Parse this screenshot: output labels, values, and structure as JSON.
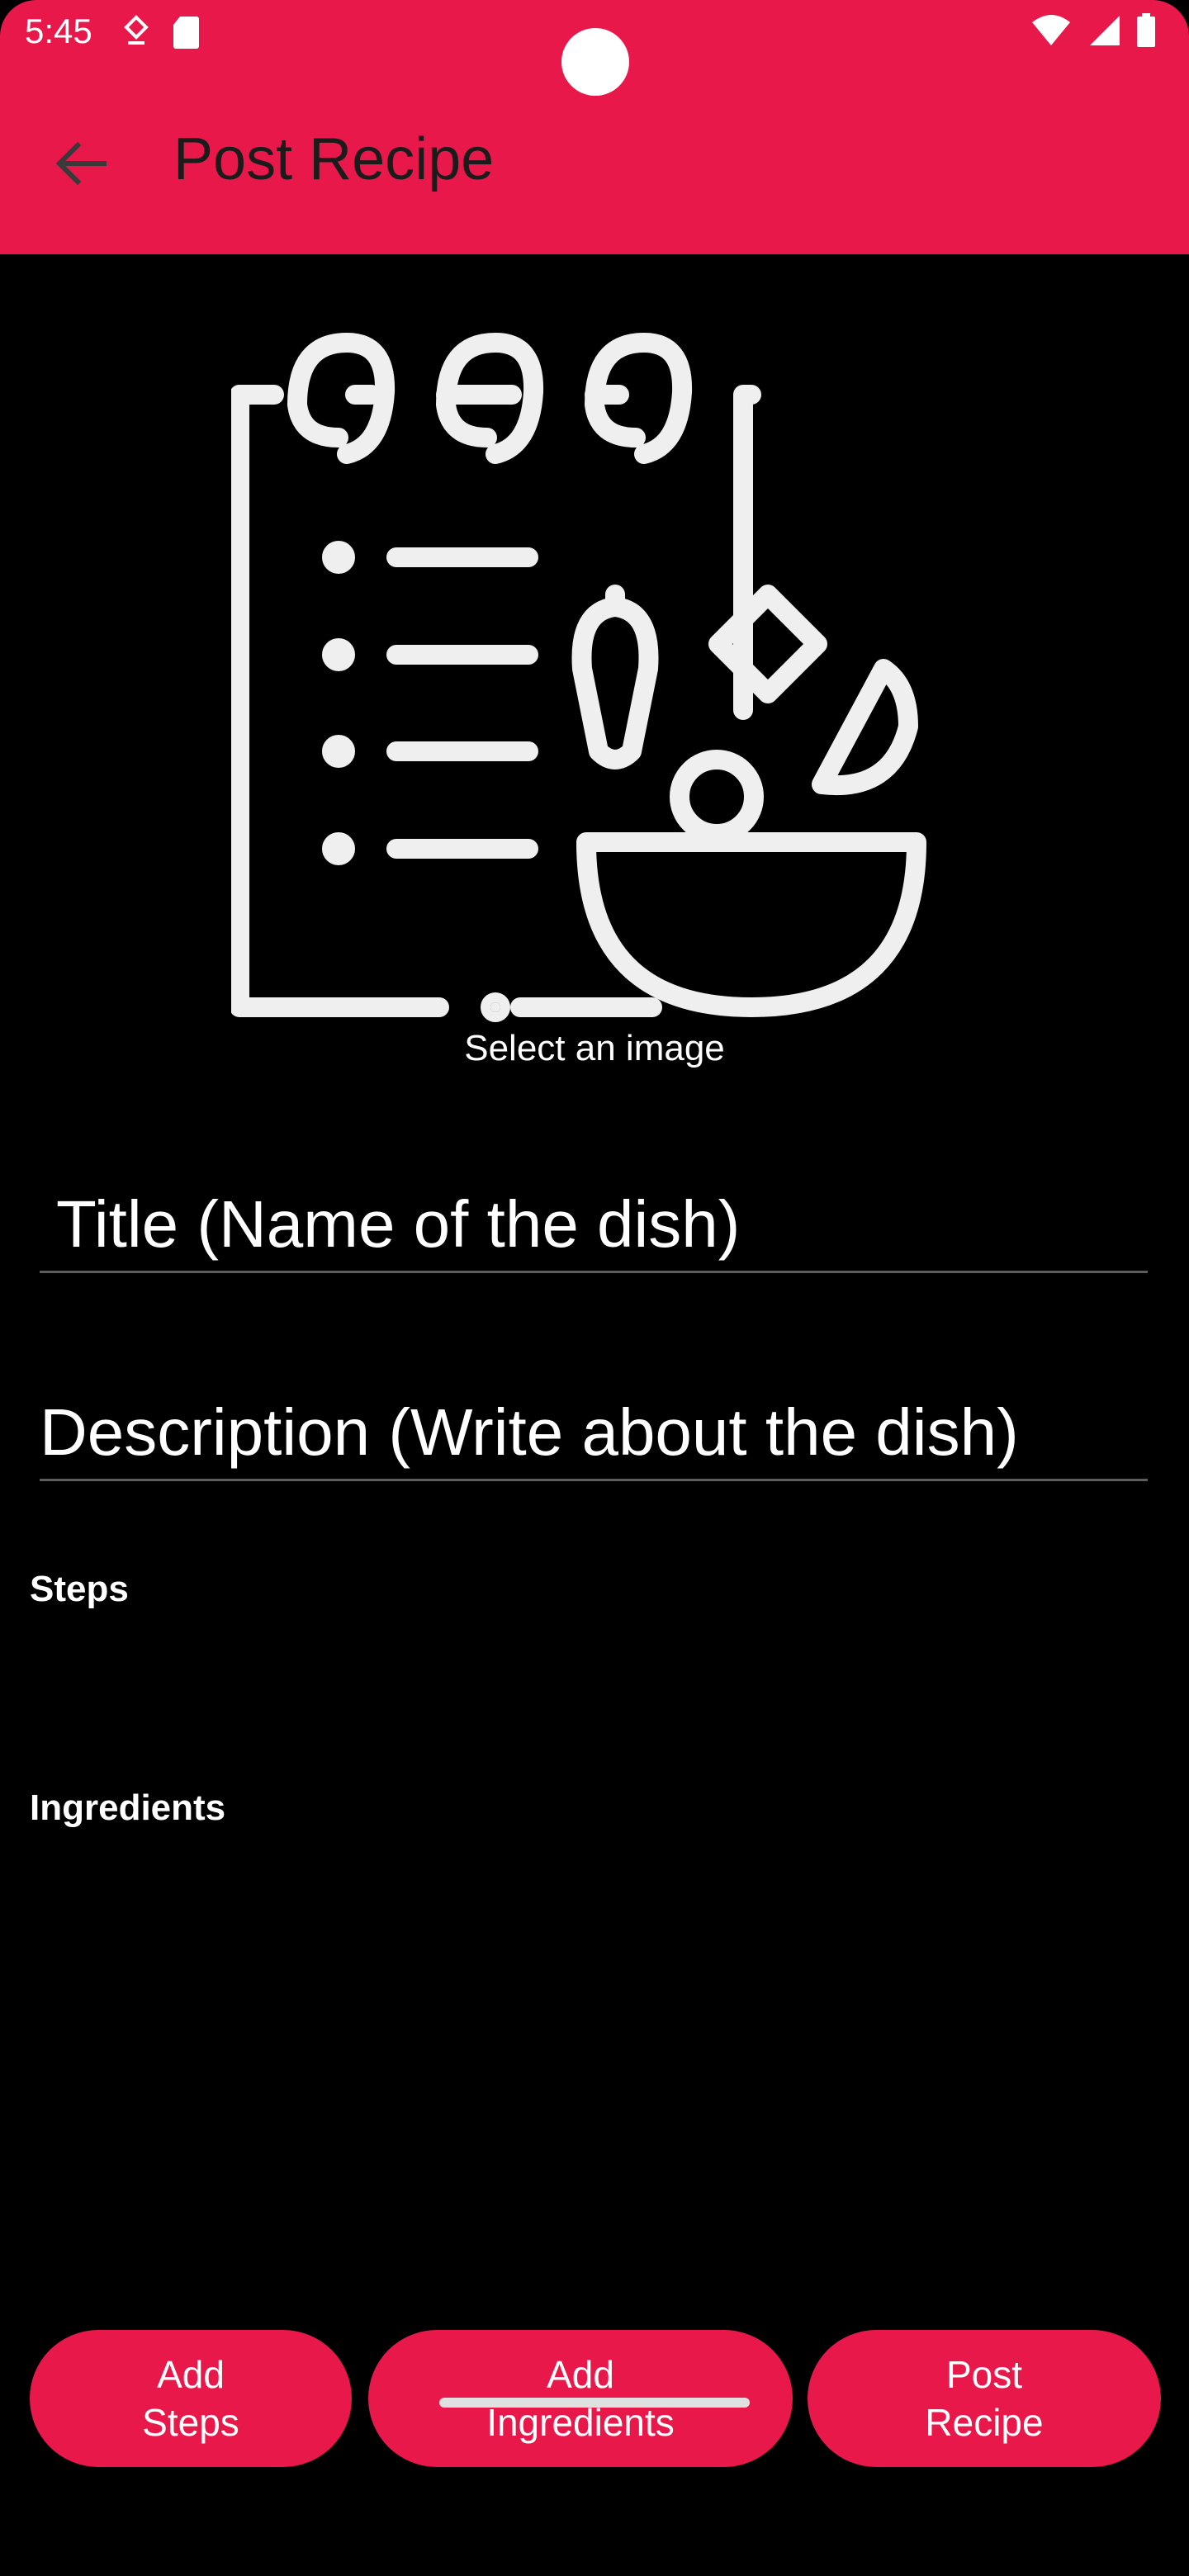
{
  "status_bar": {
    "time": "5:45",
    "icons_left": [
      "location-icon",
      "sd-card-icon"
    ],
    "icons_right": [
      "wifi-icon",
      "signal-icon",
      "battery-icon"
    ]
  },
  "app_bar": {
    "title": "Post Recipe",
    "back_icon": "arrow-back-icon",
    "color": "#E8194A"
  },
  "image_picker": {
    "icon": "recipe-notebook-icon",
    "caption": "Select an image"
  },
  "form": {
    "title_placeholder": "Title (Name of the dish)",
    "description_placeholder": "Description (Write about the dish)"
  },
  "sections": {
    "steps_label": "Steps",
    "ingredients_label": "Ingredients"
  },
  "buttons": {
    "add_steps": [
      "Add",
      "Steps"
    ],
    "add_ingredients": [
      "Add",
      "Ingredients"
    ],
    "post_recipe": [
      "Post",
      "Recipe"
    ]
  }
}
